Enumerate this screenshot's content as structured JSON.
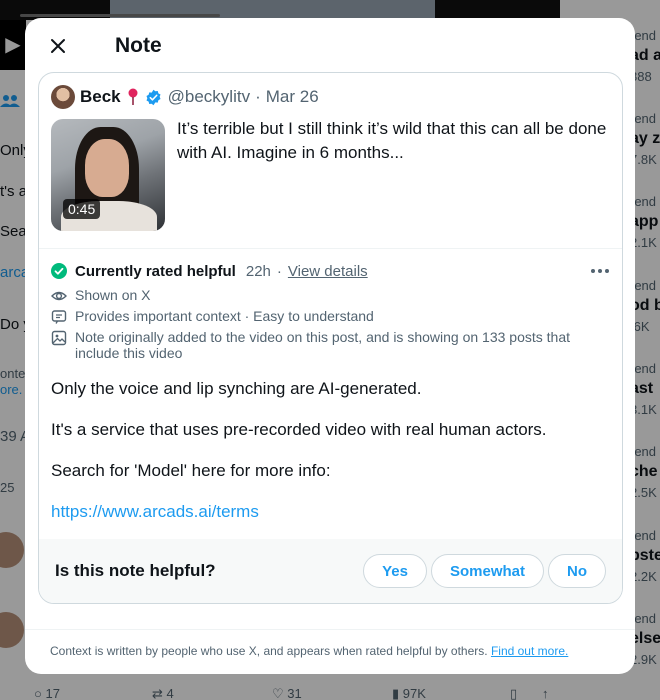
{
  "modal": {
    "title": "Note"
  },
  "post": {
    "author_name": "Beck",
    "handle": "@beckylitv",
    "separator": "·",
    "date": "Mar 26",
    "video_duration": "0:45",
    "text": "It’s terrible but I still think it’s wild that this can all be done with AI. Imagine in 6 months..."
  },
  "note": {
    "status": "Currently rated helpful",
    "time": "22h",
    "separator": "·",
    "view_details": "View details",
    "meta": [
      "Shown on X",
      "Provides important context · Easy to understand",
      "Note originally added to the video on this post, and is showing on 133 posts that include this video"
    ],
    "body": [
      "Only the voice and lip synching are AI-generated.",
      "It's a service that uses pre-recorded video with real human actors.",
      "Search for 'Model' here for more info:"
    ],
    "link": "https://www.arcads.ai/terms"
  },
  "helpful": {
    "question": "Is this note helpful?",
    "yes": "Yes",
    "somewhat": "Somewhat",
    "no": "No"
  },
  "footer": {
    "text": "Context is written by people who use X, and appears when rated helpful by others.",
    "link": "Find out more."
  },
  "background": {
    "left_fragments": [
      "Only",
      "t's a",
      "Sea",
      "arca",
      "Do y",
      "ontex",
      "ore.",
      "39 A",
      "25"
    ],
    "trends": [
      {
        "label": "rend",
        "name": "ad a",
        "count": "888"
      },
      {
        "label": "rend",
        "name": "ay z",
        "count": "7.8K"
      },
      {
        "label": "rend",
        "name": "app",
        "count": "2.1K"
      },
      {
        "label": "rend",
        "name": "od b",
        "count": ".6K"
      },
      {
        "label": "rend",
        "name": "ast",
        "count": "3.1K"
      },
      {
        "label": "rend",
        "name": "che",
        "count": "2.5K"
      },
      {
        "label": "rend",
        "name": "pste",
        "count": "2.2K"
      },
      {
        "label": "rend",
        "name": "else",
        "count": "2.9K"
      }
    ],
    "actions": [
      "17",
      "4",
      "31",
      "97K"
    ]
  },
  "colors": {
    "accent": "#1d9bf0",
    "helpful_green": "#00ba7c",
    "muted_text": "#536471",
    "border": "#cfd9de"
  },
  "icons": {
    "close": "close-icon",
    "verified": "verified-badge-icon",
    "pin": "red-pin-icon",
    "check": "check-circle-icon",
    "eye": "eye-icon",
    "context": "comment-box-icon",
    "image": "image-icon",
    "more": "more-dots-icon"
  }
}
